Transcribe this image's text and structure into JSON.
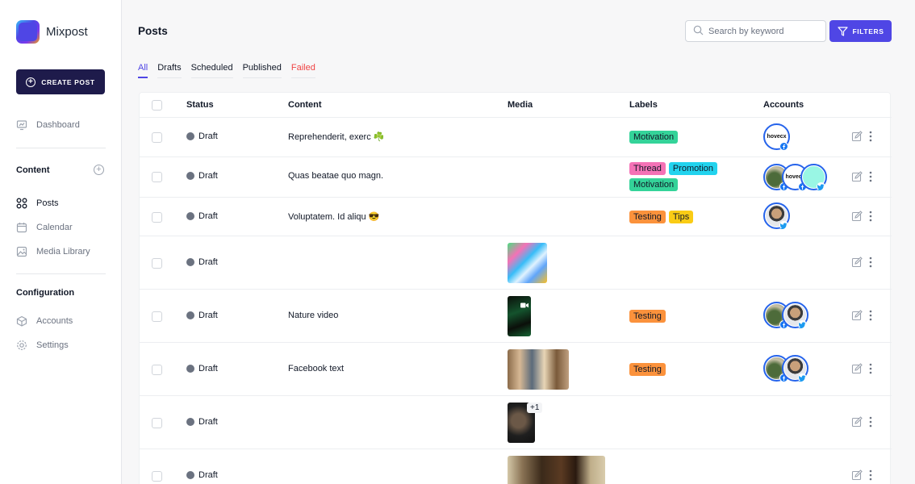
{
  "app": {
    "name": "Mixpost",
    "create_post_label": "CREATE POST"
  },
  "sidebar": {
    "dashboard": "Dashboard",
    "content_heading": "Content",
    "items": [
      "Posts",
      "Calendar",
      "Media Library"
    ],
    "config_heading": "Configuration",
    "config_items": [
      "Accounts",
      "Settings"
    ]
  },
  "header": {
    "title": "Posts",
    "search_placeholder": "Search by keyword",
    "filters_label": "FILTERS"
  },
  "tabs": [
    "All",
    "Drafts",
    "Scheduled",
    "Published",
    "Failed"
  ],
  "table": {
    "headers": [
      "Status",
      "Content",
      "Media",
      "Labels",
      "Accounts"
    ],
    "rows": [
      {
        "status": "Draft",
        "content": "Reprehenderit, exerc ☘️",
        "labels": [
          "Motivation"
        ]
      },
      {
        "status": "Draft",
        "content": "Quas beatae quo magn.",
        "labels": [
          "Thread",
          "Promotion",
          "Motivation"
        ]
      },
      {
        "status": "Draft",
        "content": "Voluptatem. Id aliqu 😎",
        "labels": [
          "Testing",
          "Tips"
        ]
      },
      {
        "status": "Draft",
        "content": "",
        "labels": []
      },
      {
        "status": "Draft",
        "content": "Nature video",
        "labels": [
          "Testing"
        ]
      },
      {
        "status": "Draft",
        "content": "Facebook text",
        "labels": [
          "Testing"
        ]
      },
      {
        "status": "Draft",
        "content": "",
        "labels": [],
        "media_more": "+1"
      },
      {
        "status": "Draft",
        "content": "",
        "labels": []
      }
    ]
  },
  "avatar_text": "hovecx",
  "colors": {
    "accent": "#4f46e5",
    "create_post_bg": "#1e1b4b",
    "failed": "#ef4444",
    "label_motivation": "#34d399",
    "label_thread": "#f472b6",
    "label_promotion": "#22d3ee",
    "label_testing": "#fb923c",
    "label_tips": "#facc15"
  }
}
